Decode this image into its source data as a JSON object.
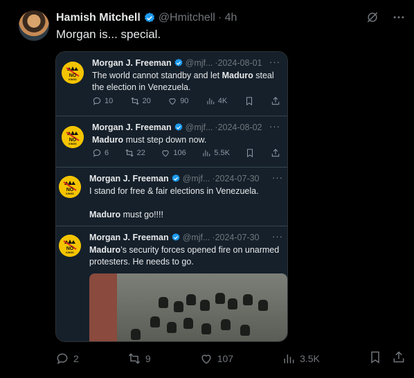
{
  "post": {
    "author_name": "Hamish Mitchell",
    "handle": "@Hmitchell",
    "time": "· 4h",
    "text": "Morgan is... special.",
    "stats": {
      "replies": "2",
      "reposts": "9",
      "likes": "107",
      "views": "3.5K"
    }
  },
  "thread": [
    {
      "name": "Morgan J. Freeman",
      "handle": "@mjf...",
      "date": "·2024-08-01",
      "text_html": "The world cannot standby and let <b>Maduro</b> steal the election in Venezuela.",
      "stats": {
        "replies": "10",
        "reposts": "20",
        "likes": "90",
        "views": "4K"
      }
    },
    {
      "name": "Morgan J. Freeman",
      "handle": "@mjf...",
      "date": "·2024-08-02",
      "text_html": "<b>Maduro</b> must step down now.",
      "stats": {
        "replies": "6",
        "reposts": "22",
        "likes": "106",
        "views": "5.5K"
      }
    },
    {
      "name": "Morgan J. Freeman",
      "handle": "@mjf...",
      "date": "·2024-07-30",
      "text_html": "I stand for free &amp; fair elections in Venezuela.<br><br><b>Maduro</b> must go!!!!"
    },
    {
      "name": "Morgan J. Freeman",
      "handle": "@mjf...",
      "date": "·2024-07-30",
      "text_html": "<b>Maduro</b>’s security forces opened fire on unarmed protesters. He needs to go."
    }
  ],
  "logo": {
    "line1": "NO",
    "line2": "KINGS"
  },
  "colors": {
    "verified": "#1d9bf0",
    "logo_yellow": "#f5c400",
    "logo_red": "#d62d20"
  }
}
